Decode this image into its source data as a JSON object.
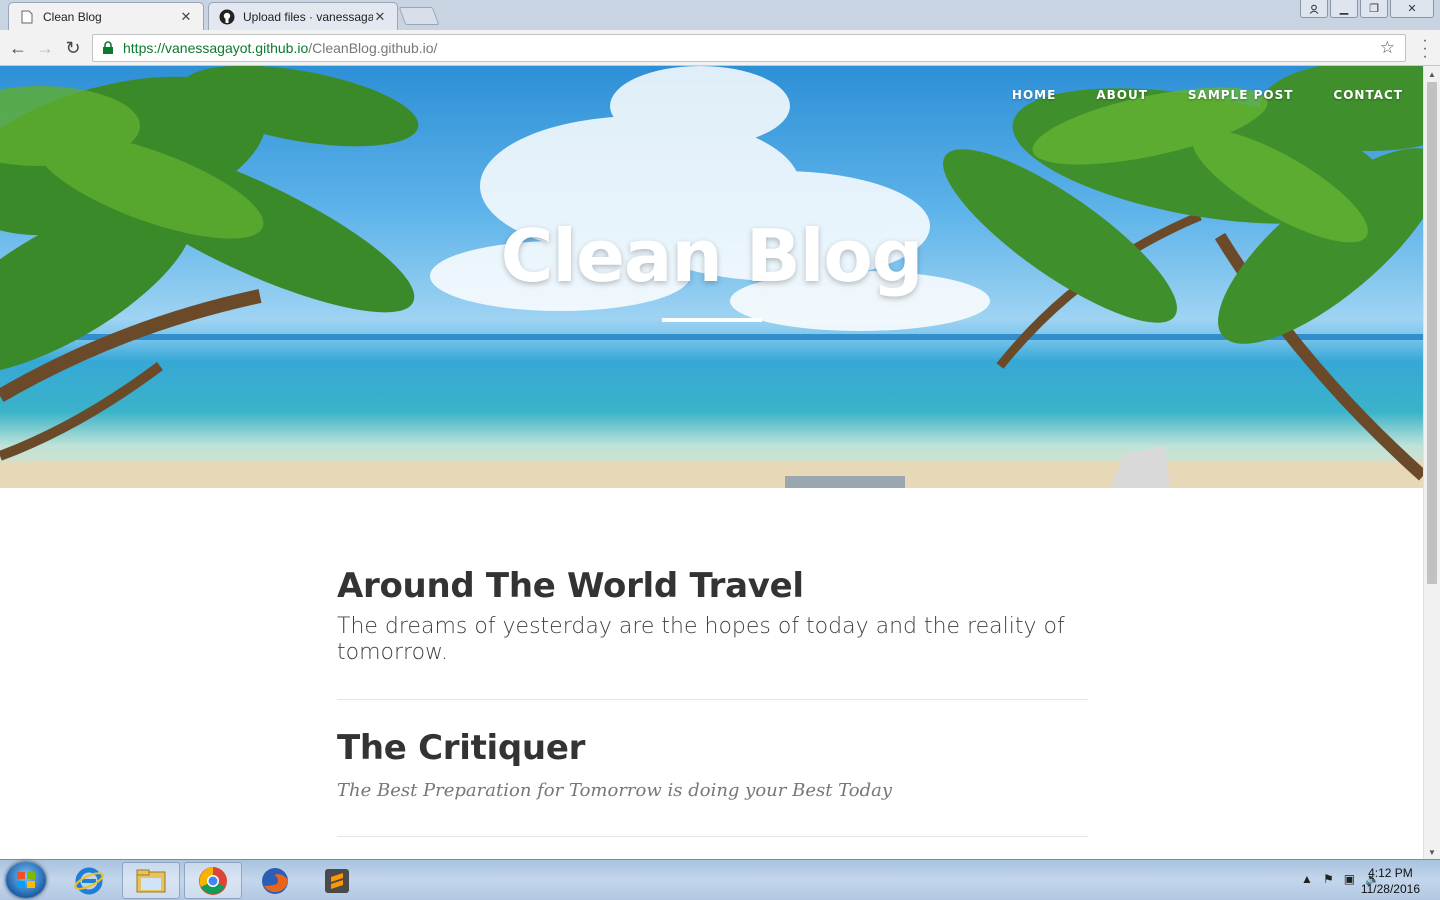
{
  "browser": {
    "tabs": [
      {
        "title": "Clean Blog",
        "icon": "page-icon",
        "active": true
      },
      {
        "title": "Upload files · vanessagay",
        "icon": "github-icon",
        "active": false
      }
    ],
    "url": {
      "host": "https://vanessagayot.github.io",
      "path": "/CleanBlog.github.io/"
    }
  },
  "site": {
    "nav": [
      "HOME",
      "ABOUT",
      "SAMPLE POST",
      "CONTACT"
    ],
    "title": "Clean Blog"
  },
  "posts": [
    {
      "title": "Around The World Travel",
      "subtitle": "The dreams of yesterday are the hopes of today and the reality of tomorrow."
    },
    {
      "title": "The Critiquer",
      "subtitle": "The Best Preparation for Tomorrow is doing your Best Today"
    }
  ],
  "taskbar": {
    "apps": [
      "internet-explorer-icon",
      "file-explorer-icon",
      "chrome-icon",
      "firefox-icon",
      "sublime-text-icon"
    ],
    "time": "4:12 PM",
    "date": "11/28/2016"
  },
  "colors": {
    "url_host": "#0b7a2e",
    "post_title": "#333333",
    "accent": "#ffffff"
  }
}
